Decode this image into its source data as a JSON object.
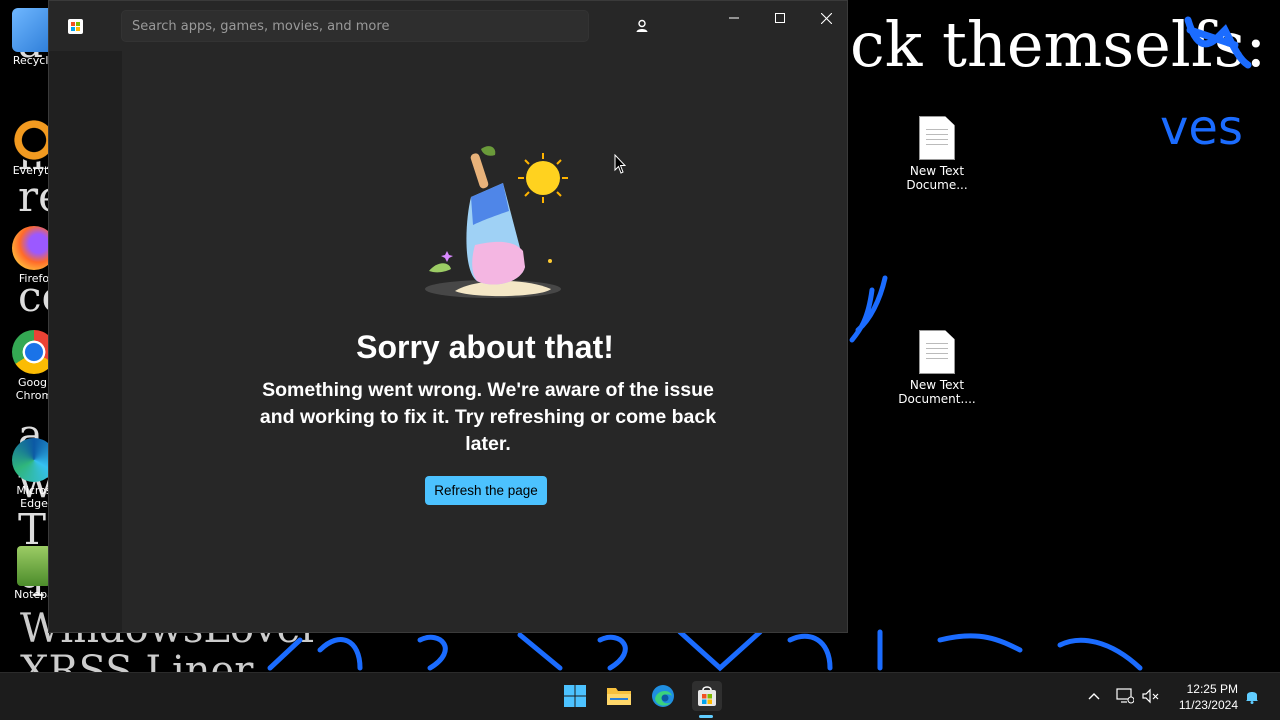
{
  "desktop": {
    "wallpaper_heading": "ck themselfs:",
    "wallpaper_left": [
      "a",
      "in",
      "re",
      "co",
      "a",
      "w",
      "T",
      "q"
    ],
    "wallpaper_bottom": [
      "WindowsLover",
      "XRSS Liner"
    ],
    "handwriting": [
      "ves",
      "y"
    ],
    "files": [
      {
        "label": "New Text Docume..."
      },
      {
        "label": "New Text Document...."
      }
    ],
    "left_icons": [
      {
        "label": "Recycle",
        "icon": "recycle-bin-icon"
      },
      {
        "label": "Everyth",
        "icon": "everything-search-icon"
      },
      {
        "label": "Firefo",
        "icon": "firefox-icon"
      },
      {
        "label": "Googl Chrom",
        "icon": "chrome-icon"
      },
      {
        "label": "Micros Edge",
        "icon": "edge-icon"
      },
      {
        "label": "Notepa",
        "icon": "notepad-icon"
      }
    ]
  },
  "window": {
    "app": "Microsoft Store",
    "search": {
      "placeholder": "Search apps, games, movies, and more",
      "value": ""
    },
    "controls": {
      "minimize": "minimize",
      "maximize": "maximize",
      "close": "close"
    },
    "error": {
      "title": "Sorry about that!",
      "message": "Something went wrong. We're aware of the issue and working to fix it. Try refreshing or come back later.",
      "button": "Refresh the page"
    }
  },
  "taskbar": {
    "apps": [
      {
        "name": "start-button",
        "icon": "windows-logo-icon"
      },
      {
        "name": "file-explorer",
        "icon": "folder-icon"
      },
      {
        "name": "edge",
        "icon": "edge-icon"
      },
      {
        "name": "microsoft-store",
        "icon": "store-icon",
        "active": true
      }
    ],
    "clock": {
      "time": "12:25 PM",
      "date": "11/23/2024"
    }
  },
  "colors": {
    "accent": "#4cc2ff",
    "window_bg": "#272727",
    "taskbar_bg": "#1c1c1c"
  }
}
